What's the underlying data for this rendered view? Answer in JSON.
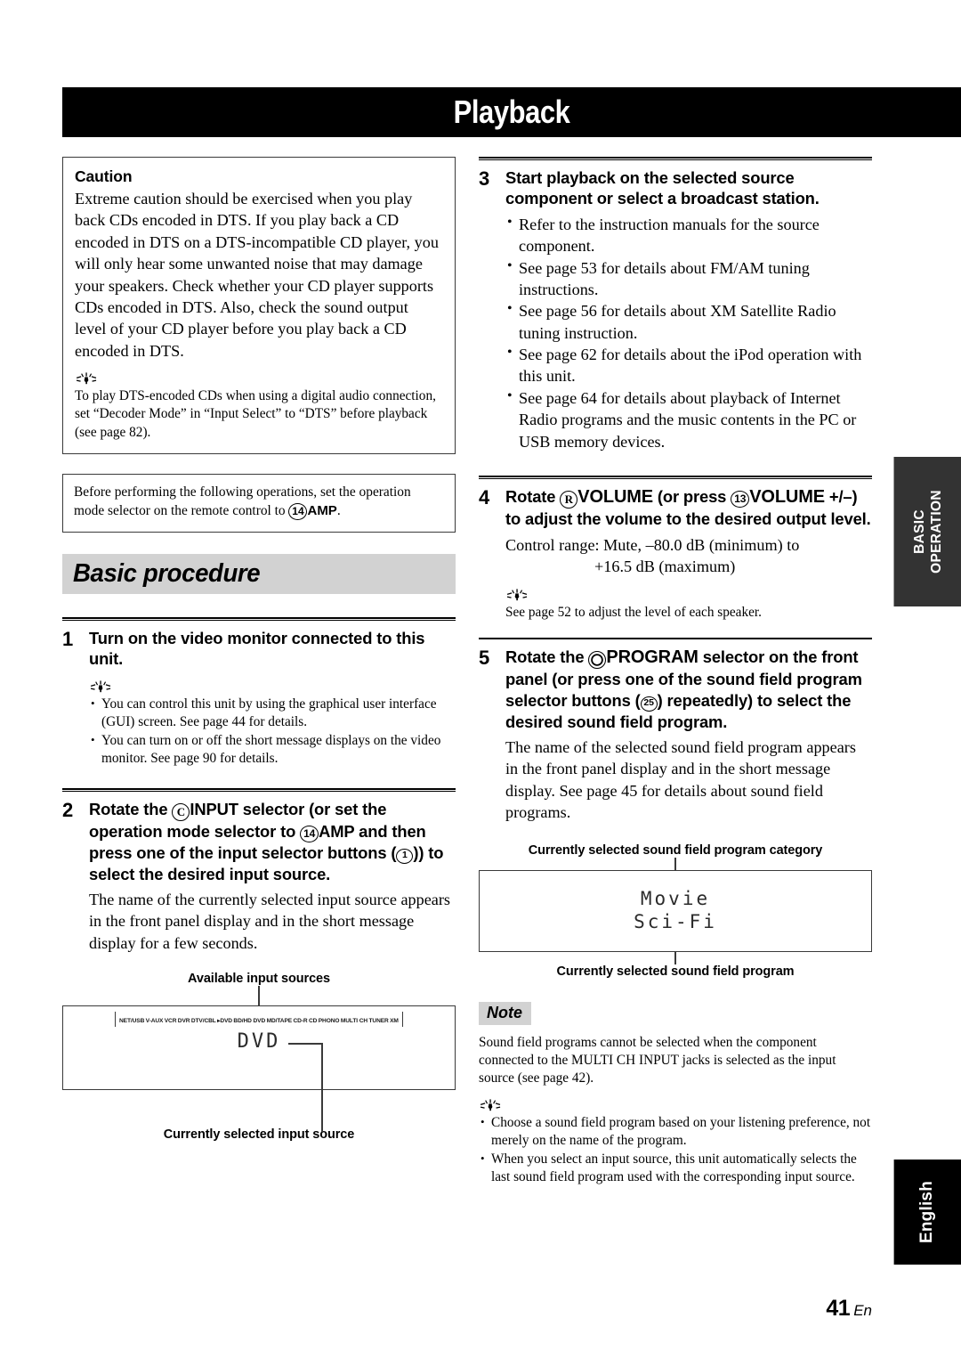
{
  "page": {
    "title": "Playback",
    "number": "41",
    "lang_mark": "En"
  },
  "side_tabs": {
    "section_line1": "BASIC",
    "section_line2": "OPERATION",
    "language": "English"
  },
  "left_column": {
    "caution_box": {
      "heading": "Caution",
      "body": "Extreme caution should be exercised when you play back CDs encoded in DTS. If you play back a CD encoded in DTS on a DTS-incompatible CD player, you will only hear some unwanted noise that may damage your speakers. Check whether your CD player supports CDs encoded in DTS. Also, check the sound output level of your CD player before you play back a CD encoded in DTS.",
      "tip_icon": "tip-sunburst-icon",
      "tip": "To play DTS-encoded CDs when using a digital audio connection, set “Decoder Mode” in “Input Select” to “DTS” before playback (see page 82)."
    },
    "prenote_box": {
      "text_before": "Before performing the following operations, set the operation mode selector on the remote control to ",
      "ref_number": "14",
      "ref_label": "AMP",
      "text_after": "."
    },
    "section_heading": "Basic procedure",
    "step1": {
      "number": "1",
      "heading": "Turn on the video monitor connected to this unit.",
      "tip_icon": "tip-sunburst-icon",
      "bullets": [
        "You can control this unit by using the graphical user interface (GUI) screen. See page 44 for details.",
        "You can turn on or off the short message displays on the video monitor. See page 90 for details."
      ]
    },
    "step2": {
      "number": "2",
      "head_part1": "Rotate the ",
      "head_ref1": "C",
      "head_label1": "INPUT",
      "head_part2": " selector (or set the operation mode selector to ",
      "head_ref2": "14",
      "head_label2": "AMP",
      "head_part3": " and then press one of the input selector buttons (",
      "head_ref3": "1",
      "head_part4": ")) to select the desired input source.",
      "body": "The name of the currently selected input source appears in the front panel display and in the short message display for a few seconds.",
      "figure": {
        "caption_top": "Available input sources",
        "caption_bottom": "Currently selected input source",
        "sources": [
          "NET/USB",
          "V-AUX",
          "VCR",
          "DVR",
          "DTV/CBL",
          "▸DVD",
          "BD/HD DVD",
          "MD/TAPE",
          "CD-R",
          "CD",
          "PHONO",
          "MULTI CH",
          "TUNER",
          "XM"
        ],
        "lcd_text": "DVD"
      }
    }
  },
  "right_column": {
    "step3": {
      "number": "3",
      "heading": "Start playback on the selected source component or select a broadcast station.",
      "bullets": [
        "Refer to the instruction manuals for the source component.",
        "See page 53 for details about FM/AM tuning instructions.",
        "See page 56 for details about XM Satellite Radio tuning instruction.",
        "See page 62 for details about the iPod operation with this unit.",
        "See page 64 for details about playback of Internet Radio programs and the music contents in the PC or USB memory devices."
      ]
    },
    "step4": {
      "number": "4",
      "head_part1": "Rotate ",
      "head_ref1": "R",
      "head_label1": "VOLUME",
      "head_part2": " (or press ",
      "head_ref2": "13",
      "head_label2": "VOLUME",
      "head_part3": " +/–)",
      "head_part4": "to adjust the volume to the desired output level.",
      "control_range_line1": "Control range: Mute, –80.0 dB (minimum) to",
      "control_range_line2": "+16.5 dB (maximum)",
      "tip_icon": "tip-sunburst-icon",
      "tip": "See page 52 to adjust the level of each speaker."
    },
    "step5": {
      "number": "5",
      "head_part1": "Rotate the ",
      "head_ref1": "O",
      "head_label1": "PROGRAM",
      "head_part2": " selector on the front panel (or press one of the sound field program selector buttons (",
      "head_ref2": "25",
      "head_part3": ") repeatedly) to select the desired sound field program.",
      "body": "The name of the selected sound field program appears in the front panel display and in the short message display. See page 45 for details about sound field programs.",
      "figure": {
        "caption_top": "Currently selected sound field program category",
        "caption_bottom": "Currently selected sound field program",
        "lcd_line1": "Movie",
        "lcd_line2": "Sci-Fi"
      }
    },
    "note": {
      "tag": "Note",
      "body": "Sound field programs cannot be selected when the component connected to the MULTI CH INPUT jacks is selected as the input source (see page 42).",
      "tip_icon": "tip-sunburst-icon",
      "bullets": [
        "Choose a sound field program based on your listening preference, not merely on the name of the program.",
        "When you select an input source, this unit automatically selects the last sound field program used with the corresponding input source."
      ]
    }
  },
  "colors": {
    "band_gray": "#d2d2d2",
    "tab_dark": "#333333",
    "tab_black": "#000000"
  }
}
